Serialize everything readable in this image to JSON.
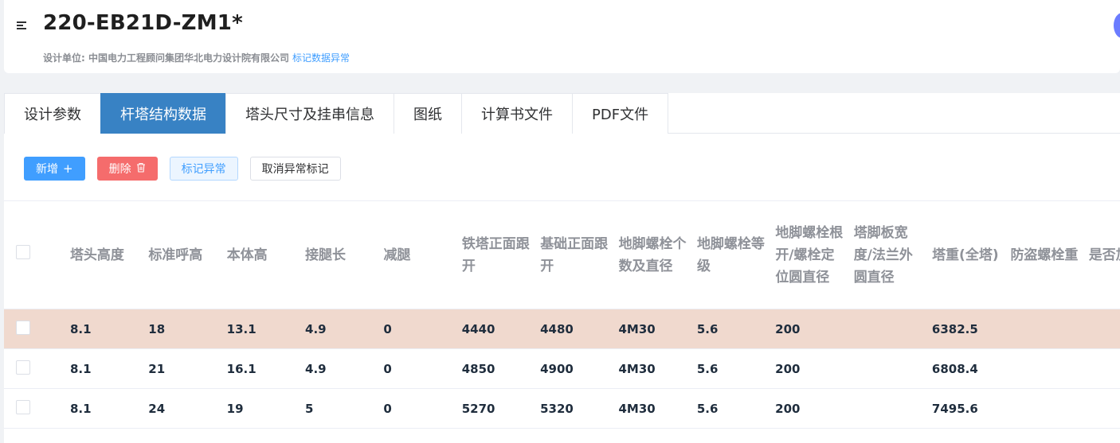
{
  "header": {
    "title": "220-EB21D-ZM1*",
    "design_unit_label": "设计单位: 中国电力工程顾问集团华北电力设计院有限公司",
    "mark_link": "标记数据异常"
  },
  "tabs": [
    {
      "label": "设计参数",
      "active": false
    },
    {
      "label": "杆塔结构数据",
      "active": true
    },
    {
      "label": "塔头尺寸及挂串信息",
      "active": false
    },
    {
      "label": "图纸",
      "active": false
    },
    {
      "label": "计算书文件",
      "active": false
    },
    {
      "label": "PDF文件",
      "active": false
    }
  ],
  "toolbar": {
    "add_label": "新增",
    "delete_label": "删除",
    "mark_label": "标记异常",
    "unmark_label": "取消异常标记"
  },
  "table": {
    "columns": [
      "塔头高度",
      "标准呼高",
      "本体高",
      "接腿长",
      "减腿",
      "铁塔正面跟开",
      "基础正面跟开",
      "地脚螺栓个数及直径",
      "地脚螺栓等级",
      "地脚螺栓根开/螺栓定位圆直径",
      "塔脚板宽度/法兰外圆直径",
      "塔重(全塔)",
      "防盗螺栓重",
      "是否加强"
    ],
    "rows": [
      {
        "cells": [
          "8.1",
          "18",
          "13.1",
          "4.9",
          "0",
          "4440",
          "4480",
          "4M30",
          "5.6",
          "200",
          "",
          "6382.5",
          "",
          ""
        ],
        "highlighted": true
      },
      {
        "cells": [
          "8.1",
          "21",
          "16.1",
          "4.9",
          "0",
          "4850",
          "4900",
          "4M30",
          "5.6",
          "200",
          "",
          "6808.4",
          "",
          ""
        ],
        "highlighted": false
      },
      {
        "cells": [
          "8.1",
          "24",
          "19",
          "5",
          "0",
          "5270",
          "5320",
          "4M30",
          "5.6",
          "200",
          "",
          "7495.6",
          "",
          ""
        ],
        "highlighted": false
      }
    ]
  },
  "colors": {
    "tab_active": "#3882c4",
    "primary": "#409eff",
    "danger": "#f56c6c",
    "row_highlight": "#f0d9ce"
  }
}
